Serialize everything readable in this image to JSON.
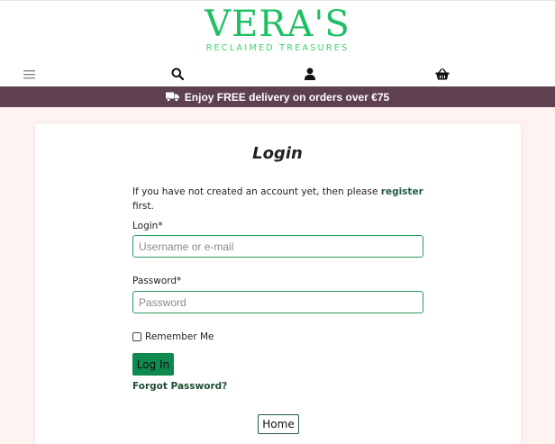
{
  "header": {
    "logo_main": "VERA'S",
    "logo_sub": "RECLAIMED TREASURES",
    "icons": [
      "hamburger-menu-icon",
      "search-icon",
      "user-icon",
      "basket-icon"
    ]
  },
  "banner": {
    "text": "Enjoy FREE delivery on orders over €75",
    "icon": "truck-icon"
  },
  "login_form": {
    "title": "Login",
    "intro_before": "If you have not created an account yet, then please ",
    "intro_link": "register",
    "intro_after": " first.",
    "login_label": "Login*",
    "login_placeholder": "Username or e-mail",
    "login_value": "",
    "password_label": "Password*",
    "password_placeholder": "Password",
    "password_value": "",
    "remember_label": "Remember Me",
    "remember_checked": false,
    "submit_label": "Log In",
    "forgot_label": "Forgot Password?",
    "home_label": "Home"
  },
  "colors": {
    "brand_green": "#1fbf63",
    "banner_bg": "#5e4050",
    "page_bg": "#fff3f1",
    "button_green": "#0f8a4e",
    "link_green": "#1e5e3e"
  }
}
